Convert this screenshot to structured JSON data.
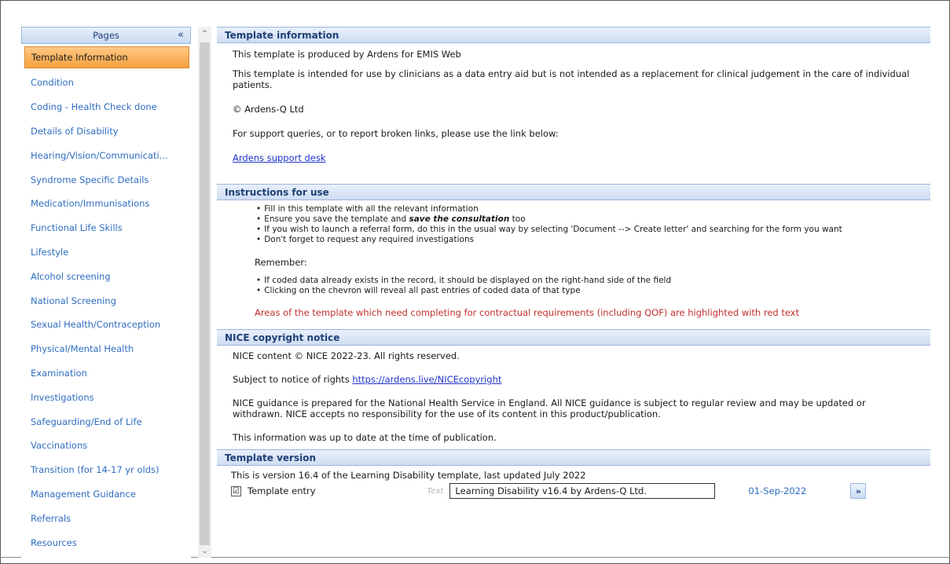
{
  "sidebar": {
    "title": "Pages",
    "collapse_glyph": "«",
    "items": [
      {
        "label": "Template Information"
      },
      {
        "label": "Condition"
      },
      {
        "label": "Coding - Health Check done"
      },
      {
        "label": "Details of Disability"
      },
      {
        "label": "Hearing/Vision/Communicati..."
      },
      {
        "label": "Syndrome Specific Details"
      },
      {
        "label": "Medication/Immunisations"
      },
      {
        "label": "Functional Life Skills"
      },
      {
        "label": "Lifestyle"
      },
      {
        "label": "Alcohol screening"
      },
      {
        "label": "National Screening"
      },
      {
        "label": "Sexual Health/Contraception"
      },
      {
        "label": "Physical/Mental Health"
      },
      {
        "label": "Examination"
      },
      {
        "label": "Investigations"
      },
      {
        "label": "Safeguarding/End of Life"
      },
      {
        "label": "Vaccinations"
      },
      {
        "label": "Transition (for 14-17 yr olds)"
      },
      {
        "label": "Management Guidance"
      },
      {
        "label": "Referrals"
      },
      {
        "label": "Resources"
      }
    ]
  },
  "scrollbar": {
    "up": "^",
    "down": "⌄"
  },
  "template_info": {
    "header": "Template information",
    "line1": "This template is produced by Ardens for EMIS Web",
    "line2": "This template is intended for use by clinicians as a data entry aid but is not intended as a replacement for clinical judgement in the care of individual patients.",
    "copyright": "© Ardens-Q Ltd",
    "support_text": "For support queries, or to report broken links, please use the link below:",
    "support_link": "Ardens support desk"
  },
  "instructions": {
    "header": "Instructions for use",
    "bullet1": "Fill in this template with all the relevant information",
    "bullet2_pre": "Ensure you save the template and ",
    "bullet2_bold": "save the consultation",
    "bullet2_post": " too",
    "bullet3": "If you wish to launch a referral form, do this in the usual way by selecting 'Document --> Create letter' and searching for the form you want",
    "bullet4": "Don't forget to request any required investigations",
    "remember": "Remember:",
    "bullet5": "If coded data already exists in the record, it should be displayed on the right-hand side of the field",
    "bullet6": "Clicking on the chevron will reveal all past entries of coded data of that type",
    "red_note": "Areas of the template which need completing for contractual requirements (including QOF) are highlighted with red text"
  },
  "nice": {
    "header": "NICE copyright notice",
    "line1": "NICE content © NICE 2022-23. All rights reserved.",
    "rights_text": "Subject to notice of rights ",
    "rights_link": "https://ardens.live/NICEcopyright",
    "guidance": "NICE guidance is prepared for the National Health Service in England. All NICE guidance is subject to regular review and may be updated or withdrawn. NICE accepts no responsibility for the use of its content in this product/publication.",
    "uptodate": "This information was up to date at the time of publication."
  },
  "version": {
    "header": "Template version",
    "line": "This is version 16.4 of the Learning Disability template, last updated July 2022",
    "checkbox_mark": "☑",
    "entry_label": "Template entry",
    "text_hint": "Text",
    "entry_value": "Learning Disability v16.4 by Ardens-Q Ltd.",
    "date": "01-Sep-2022",
    "expand_glyph": "»"
  }
}
